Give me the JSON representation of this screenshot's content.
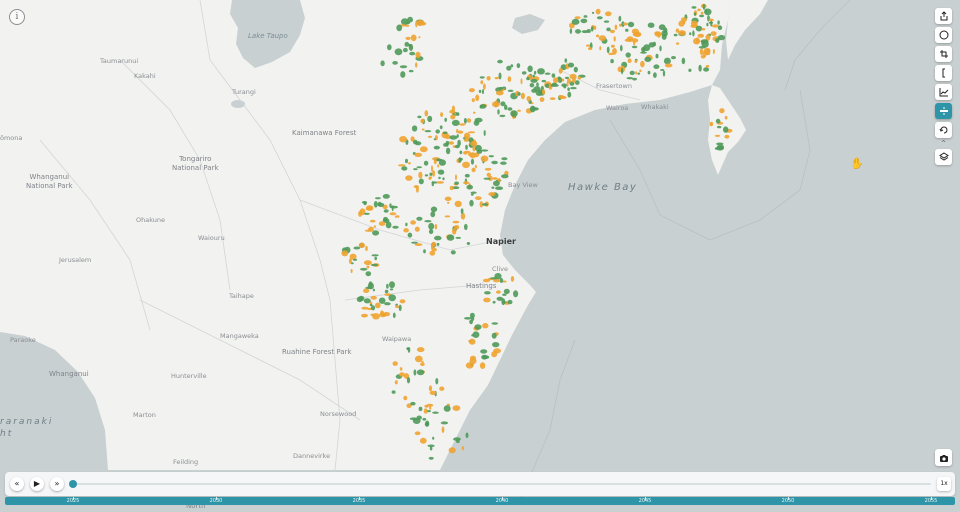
{
  "map": {
    "labels": {
      "lake_taupo": "Lake Taupo",
      "taumarunui": "Taumarunui",
      "kakahi": "Kakahi",
      "turangi": "Turangi",
      "kaimanawa_forest": "Kaimanawa Forest",
      "tongariro_np": "Tongariro\nNational Park",
      "whanganui_np": "Whanganui\nNational Park",
      "omona": "ōmona",
      "ohakune": "Ohakune",
      "waiouru": "Waiouru",
      "jerusalem": "Jerusalem",
      "taihape": "Taihape",
      "mangaweka": "Mangaweka",
      "ruahine_forest_park": "Ruahine Forest Park",
      "paraoke": "Paraoke",
      "whanganui": "Whanganui",
      "hunterville": "Hunterville",
      "marton": "Marton",
      "feilding": "Feilding",
      "dannevirke": "Dannevirke",
      "norsewood": "Norsewood",
      "napier": "Napier",
      "hastings": "Hastings",
      "clive": "Clive",
      "bay_view": "Bay View",
      "frasertown": "Frasertown",
      "wairoa": "Wairoa",
      "whakaki": "Whakaki",
      "waipawa": "Waipawa",
      "hawke_bay": "Hawke Bay",
      "taranaki_bight": "raranaki\nht",
      "north": "North"
    }
  },
  "controls": {
    "info_icon": "info-icon",
    "tools": [
      "share-icon",
      "compass-icon",
      "crop-icon",
      "bracket-icon",
      "chart-icon",
      "timeline-icon",
      "rotate-icon",
      "layers-icon"
    ],
    "camera_icon": "camera-icon",
    "cursor_icon": "hand-cursor-icon"
  },
  "timeline": {
    "rewind_label": "«",
    "play_label": "▶",
    "forward_label": "»",
    "speed_label": "1x",
    "progress": 0.0,
    "years": [
      "2025",
      "2030",
      "2035",
      "2040",
      "2045",
      "2050",
      "2055"
    ]
  },
  "colors": {
    "sea": "#c9d0d2",
    "land": "#f2f2f1",
    "forest_green": "#4f9a5a",
    "harvest_orange": "#f0a330",
    "accent": "#2e95a8"
  }
}
